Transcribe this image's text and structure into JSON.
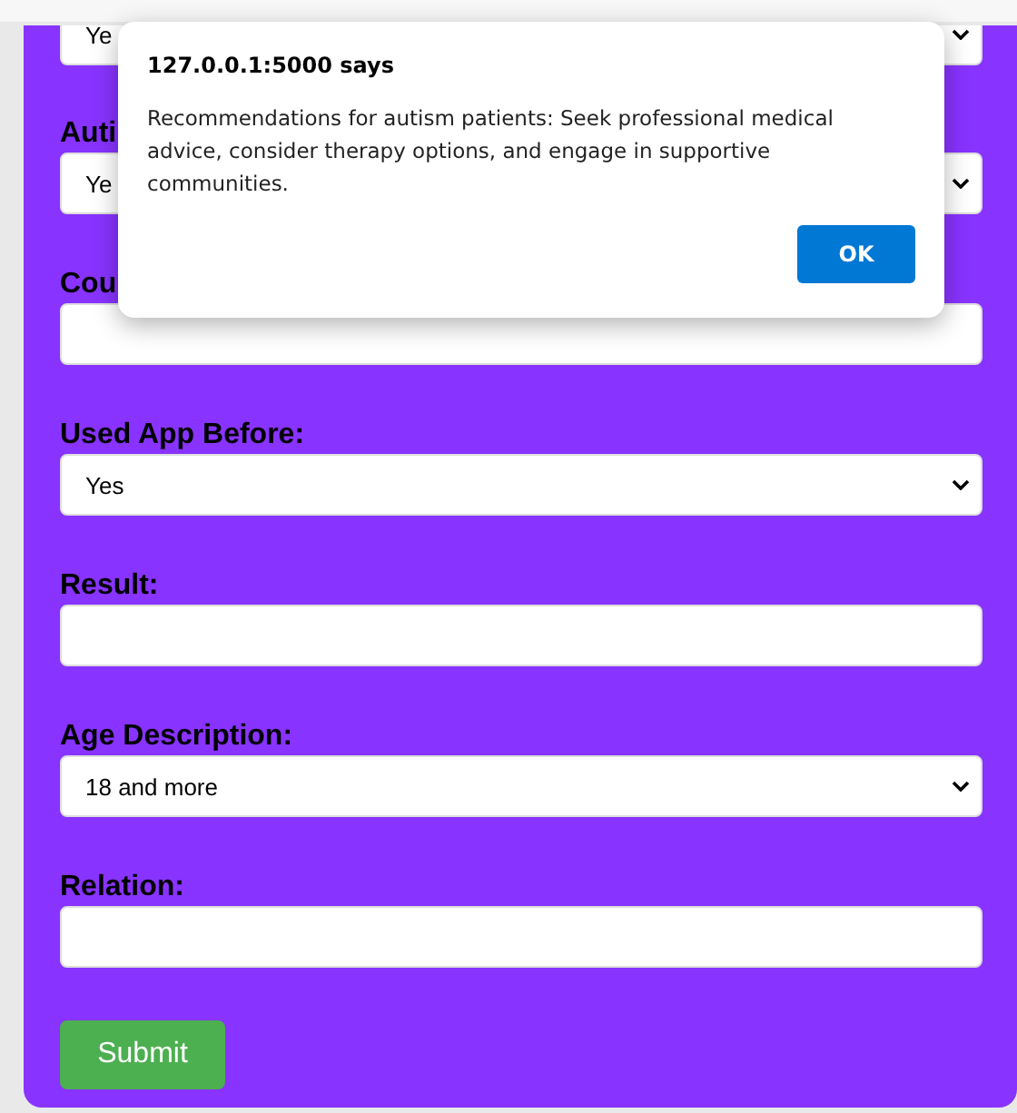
{
  "form": {
    "fields": [
      {
        "kind": "select",
        "value": "Ye"
      },
      {
        "kind": "select",
        "label": "Auti",
        "value": "Ye"
      },
      {
        "kind": "input",
        "label": "Cou"
      },
      {
        "kind": "select",
        "label": "Used App Before:",
        "value": "Yes"
      },
      {
        "kind": "input",
        "label": "Result:"
      },
      {
        "kind": "select",
        "label": "Age Description:",
        "value": "18 and more"
      },
      {
        "kind": "input",
        "label": "Relation:"
      }
    ],
    "submit": "Submit"
  },
  "dialog": {
    "title": "127.0.0.1:5000 says",
    "message": "Recommendations for autism patients: Seek professional medical advice, consider therapy options, and engage in supportive communities.",
    "button": "OK"
  }
}
